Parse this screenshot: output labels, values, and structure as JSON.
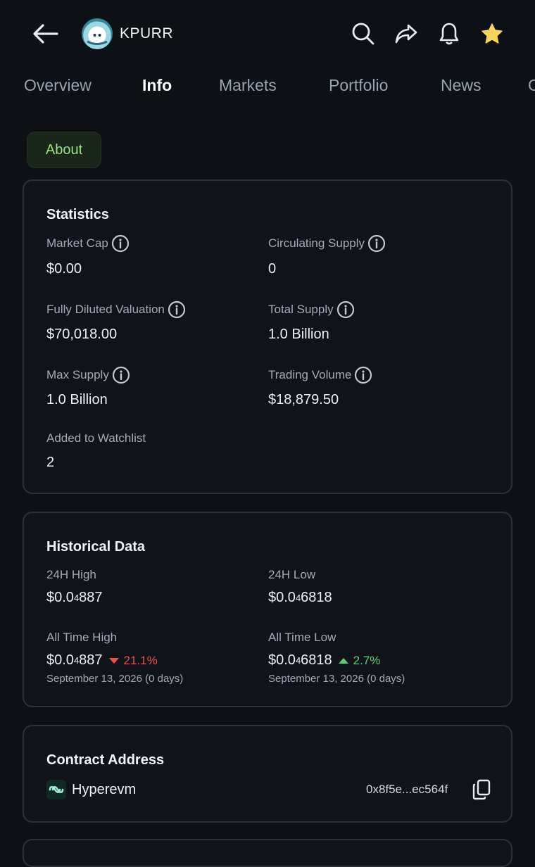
{
  "header": {
    "coin_name": "KPURR",
    "icons": [
      "back-arrow-icon",
      "search-icon",
      "share-icon",
      "bell-icon",
      "star-icon"
    ],
    "star_color": "#f7d55a"
  },
  "tabs": [
    {
      "label": "Overview",
      "active": false
    },
    {
      "label": "Info",
      "active": true
    },
    {
      "label": "Markets",
      "active": false
    },
    {
      "label": "Portfolio",
      "active": false
    },
    {
      "label": "News",
      "active": false
    }
  ],
  "about_pill": "About",
  "statistics": {
    "title": "Statistics",
    "items": [
      {
        "label": "Market Cap",
        "value": "$0.00",
        "info": true
      },
      {
        "label": "Circulating Supply",
        "value": "0",
        "info": true
      },
      {
        "label": "Fully Diluted Valuation",
        "value": "$70,018.00",
        "info": true
      },
      {
        "label": "Total Supply",
        "value": "1.0 Billion",
        "info": true
      },
      {
        "label": "Max Supply",
        "value": "1.0 Billion",
        "info": true
      },
      {
        "label": "Trading Volume",
        "value": "$18,879.50",
        "info": true
      },
      {
        "label": "Added to Watchlist",
        "value": "2",
        "info": false
      }
    ]
  },
  "historical": {
    "title": "Historical Data",
    "high_24h_label": "24H High",
    "high_24h": {
      "prefix": "$0.0",
      "zeros": "4",
      "digits": "887"
    },
    "low_24h_label": "24H Low",
    "low_24h": {
      "prefix": "$0.0",
      "zeros": "4",
      "digits": "6818"
    },
    "ath_label": "All Time High",
    "ath": {
      "prefix": "$0.0",
      "zeros": "4",
      "digits": "887",
      "change": "21.1%",
      "direction": "down",
      "date": "September 13, 2026 (0 days)"
    },
    "atl_label": "All Time Low",
    "atl": {
      "prefix": "$0.0",
      "zeros": "4",
      "digits": "6818",
      "change": "2.7%",
      "direction": "up",
      "date": "September 13, 2026 (0 days)"
    }
  },
  "contract": {
    "title": "Contract Address",
    "chain": "Hyperevm",
    "address": "0x8f5e...ec564f"
  },
  "colors": {
    "background": "#0d1015",
    "accent_green": "#9be27c",
    "down_red": "#f0504a",
    "up_green": "#58d273"
  }
}
